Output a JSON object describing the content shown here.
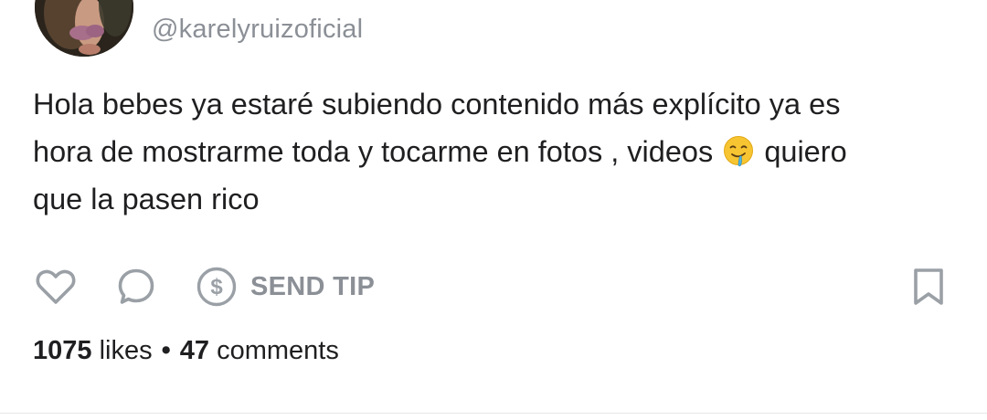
{
  "post": {
    "handle": "@karelyruizoficial",
    "text_line_1": "Hola bebes ya estaré subiendo contenido más explícito ya es",
    "text_line_2a": "hora de mostrarme toda y tocarme en fotos , videos",
    "text_line_2_emoji": "drooling-face",
    "text_line_2b": "quiero",
    "text_line_3": "que la pasen rico"
  },
  "actions": {
    "like_icon": "heart-icon",
    "comment_icon": "comment-icon",
    "tip_icon": "dollar-circle-icon",
    "tip_label": "SEND TIP",
    "bookmark_icon": "bookmark-icon"
  },
  "stats": {
    "likes_count": "1075",
    "likes_label": "likes",
    "separator": "•",
    "comments_count": "47",
    "comments_label": "comments"
  },
  "colors": {
    "text": "#1f1f21",
    "muted": "#8b8f96",
    "icon": "#9aa0a6"
  }
}
